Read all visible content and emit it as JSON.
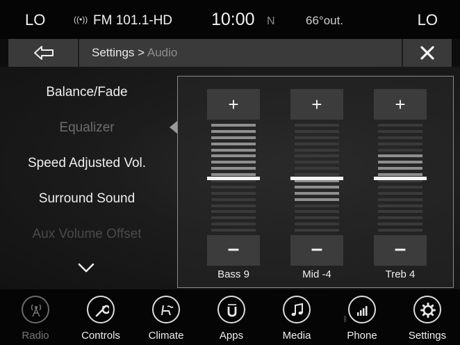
{
  "status": {
    "lo_left": "LO",
    "lo_right": "LO",
    "station": "FM 101.1-HD",
    "clock": "10:00",
    "compass": "N",
    "temperature": "66°out."
  },
  "header": {
    "breadcrumb_parent": "Settings >",
    "breadcrumb_current": "Audio"
  },
  "menu": {
    "items": [
      "Balance/Fade",
      "Equalizer",
      "Speed Adjusted Vol.",
      "Surround Sound",
      "Aux Volume Offset"
    ]
  },
  "equalizer": {
    "plus_label": "+",
    "minus_label": "–",
    "bands": [
      {
        "label": "Bass 9",
        "value": 9
      },
      {
        "label": "Mid -4",
        "value": -4
      },
      {
        "label": "Treb 4",
        "value": 4
      }
    ],
    "range": [
      -9,
      9
    ]
  },
  "nav": {
    "items": [
      {
        "label": "Radio",
        "icon": "radio-tower-icon",
        "active": false
      },
      {
        "label": "Controls",
        "icon": "wrench-icon",
        "active": true
      },
      {
        "label": "Climate",
        "icon": "climate-seat-icon",
        "active": true
      },
      {
        "label": "Apps",
        "icon": "uconnect-apps-icon",
        "active": true
      },
      {
        "label": "Media",
        "icon": "music-note-icon",
        "active": true
      },
      {
        "label": "Phone",
        "icon": "phone-signal-icon",
        "active": true
      },
      {
        "label": "Settings",
        "icon": "gear-icon",
        "active": true
      }
    ]
  },
  "colors": {
    "background": "#0d0d0d",
    "header_bar": "#3a3a3a",
    "eq_segment_on": "#8f8f8f",
    "eq_segment_off": "#3a3a3a"
  }
}
